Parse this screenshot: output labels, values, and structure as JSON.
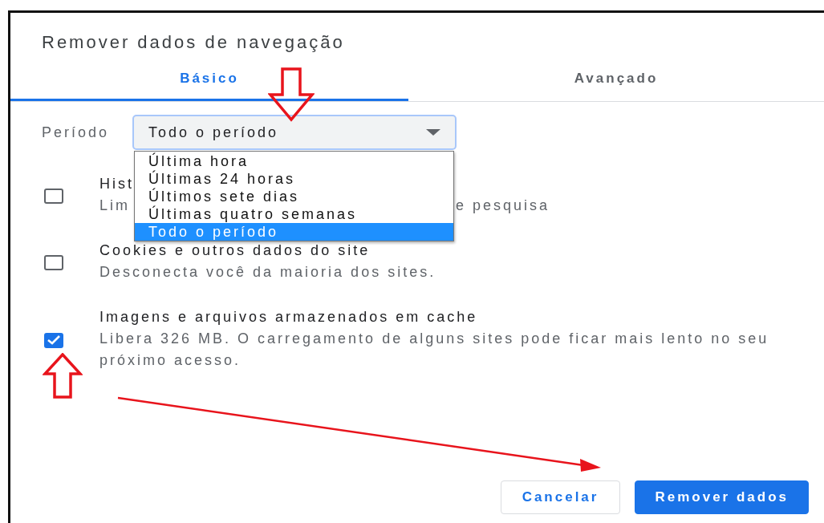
{
  "dialog": {
    "title": "Remover dados de navegação"
  },
  "tabs": [
    {
      "label": "Básico",
      "selected": true
    },
    {
      "label": "Avançado",
      "selected": false
    }
  ],
  "period": {
    "label": "Período",
    "value": "Todo o período",
    "options": [
      {
        "label": "Última hora",
        "selected": false
      },
      {
        "label": "Últimas 24 horas",
        "selected": false
      },
      {
        "label": "Últimos sete dias",
        "selected": false
      },
      {
        "label": "Últimas quatro semanas",
        "selected": false
      },
      {
        "label": "Todo o período",
        "selected": true
      }
    ]
  },
  "items": [
    {
      "title": "Hist",
      "description": [
        "Lim",
        "e pesquisa"
      ],
      "checked": false
    },
    {
      "title": "Cookies e outros dados do site",
      "description": [
        "Desconecta você da maioria dos sites."
      ],
      "checked": false
    },
    {
      "title": "Imagens e arquivos armazenados em cache",
      "description": [
        "Libera 326 MB. O carregamento de alguns sites pode ficar mais lento no seu próximo acesso."
      ],
      "checked": true
    }
  ],
  "buttons": [
    {
      "label": "Cancelar",
      "kind": "secondary"
    },
    {
      "label": "Remover dados",
      "kind": "primary"
    }
  ]
}
